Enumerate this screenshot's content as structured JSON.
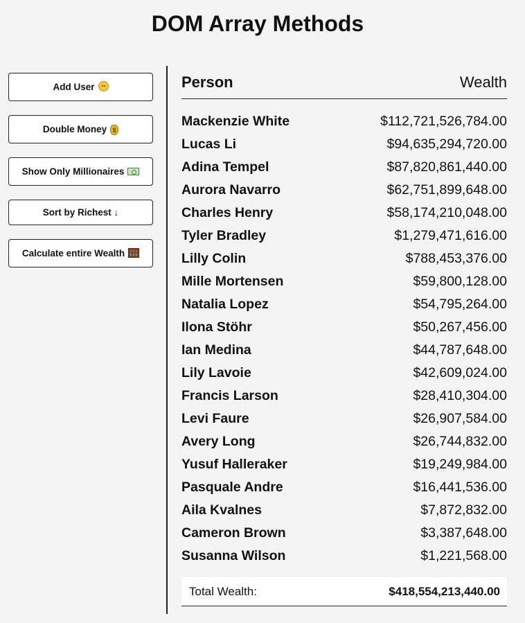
{
  "title": "DOM Array Methods",
  "buttons": [
    {
      "label": "Add User",
      "icon": "smiley-face-icon"
    },
    {
      "label": "Double Money",
      "icon": "money-bag-icon"
    },
    {
      "label": "Show Only Millionaires",
      "icon": "banknote-icon"
    },
    {
      "label": "Sort by Richest ↓",
      "icon": ""
    },
    {
      "label": "Calculate entire Wealth",
      "icon": "abacus-icon"
    }
  ],
  "table": {
    "header_person": "Person",
    "header_wealth": "Wealth",
    "rows": [
      {
        "name": "Mackenzie White",
        "wealth": "$112,721,526,784.00"
      },
      {
        "name": "Lucas Li",
        "wealth": "$94,635,294,720.00"
      },
      {
        "name": "Adina Tempel",
        "wealth": "$87,820,861,440.00"
      },
      {
        "name": "Aurora Navarro",
        "wealth": "$62,751,899,648.00"
      },
      {
        "name": "Charles Henry",
        "wealth": "$58,174,210,048.00"
      },
      {
        "name": "Tyler Bradley",
        "wealth": "$1,279,471,616.00"
      },
      {
        "name": "Lilly Colin",
        "wealth": "$788,453,376.00"
      },
      {
        "name": "Mille Mortensen",
        "wealth": "$59,800,128.00"
      },
      {
        "name": "Natalia Lopez",
        "wealth": "$54,795,264.00"
      },
      {
        "name": "Ilona Stöhr",
        "wealth": "$50,267,456.00"
      },
      {
        "name": "Ian Medina",
        "wealth": "$44,787,648.00"
      },
      {
        "name": "Lily Lavoie",
        "wealth": "$42,609,024.00"
      },
      {
        "name": "Francis Larson",
        "wealth": "$28,410,304.00"
      },
      {
        "name": "Levi Faure",
        "wealth": "$26,907,584.00"
      },
      {
        "name": "Avery Long",
        "wealth": "$26,744,832.00"
      },
      {
        "name": "Yusuf Halleraker",
        "wealth": "$19,249,984.00"
      },
      {
        "name": "Pasquale Andre",
        "wealth": "$16,441,536.00"
      },
      {
        "name": "Aila Kvalnes",
        "wealth": "$7,872,832.00"
      },
      {
        "name": "Cameron Brown",
        "wealth": "$3,387,648.00"
      },
      {
        "name": "Susanna Wilson",
        "wealth": "$1,221,568.00"
      }
    ],
    "total_label": "Total Wealth:",
    "total_value": "$418,554,213,440.00"
  }
}
